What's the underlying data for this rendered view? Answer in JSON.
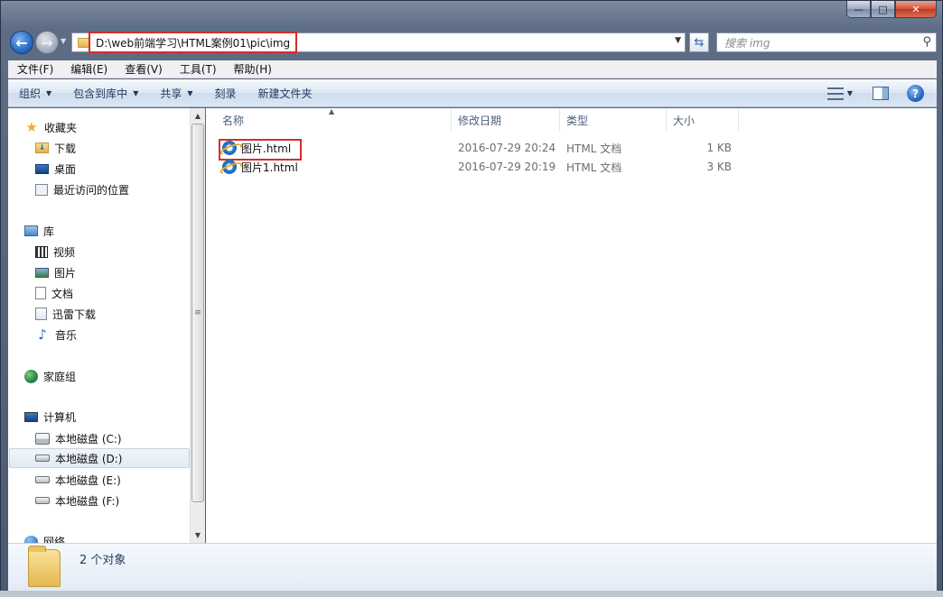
{
  "window": {
    "caption_buttons": {
      "minimize": "—",
      "maximize": "□",
      "close": "✕"
    }
  },
  "nav": {
    "address": "D:\\web前端学习\\HTML案例01\\pic\\img",
    "search_placeholder": "搜索 img"
  },
  "menu": [
    "文件(F)",
    "编辑(E)",
    "查看(V)",
    "工具(T)",
    "帮助(H)"
  ],
  "commands": {
    "organize": "组织",
    "include_library": "包含到库中",
    "share": "共享",
    "burn": "刻录",
    "new_folder": "新建文件夹"
  },
  "sidebar": {
    "favorites": {
      "label": "收藏夹",
      "items": [
        "下载",
        "桌面",
        "最近访问的位置"
      ]
    },
    "libraries": {
      "label": "库",
      "items": [
        "视频",
        "图片",
        "文档",
        "迅雷下载",
        "音乐"
      ]
    },
    "homegroup": {
      "label": "家庭组"
    },
    "computer": {
      "label": "计算机",
      "items": [
        "本地磁盘 (C:)",
        "本地磁盘 (D:)",
        "本地磁盘 (E:)",
        "本地磁盘 (F:)"
      ],
      "selected": "本地磁盘 (D:)"
    },
    "network": {
      "label": "网络"
    }
  },
  "columns": {
    "name": "名称",
    "modified": "修改日期",
    "type": "类型",
    "size": "大小"
  },
  "files": [
    {
      "name": "图片.html",
      "modified": "2016-07-29 20:24",
      "type": "HTML 文档",
      "size": "1 KB",
      "icon": "ie-html-icon"
    },
    {
      "name": "图片1.html",
      "modified": "2016-07-29 20:19",
      "type": "HTML 文档",
      "size": "3 KB",
      "icon": "ie-html-icon"
    }
  ],
  "details": {
    "count": "2 个对象"
  },
  "colors": {
    "highlight": "#d62c2c",
    "command_text": "#1e395b"
  }
}
